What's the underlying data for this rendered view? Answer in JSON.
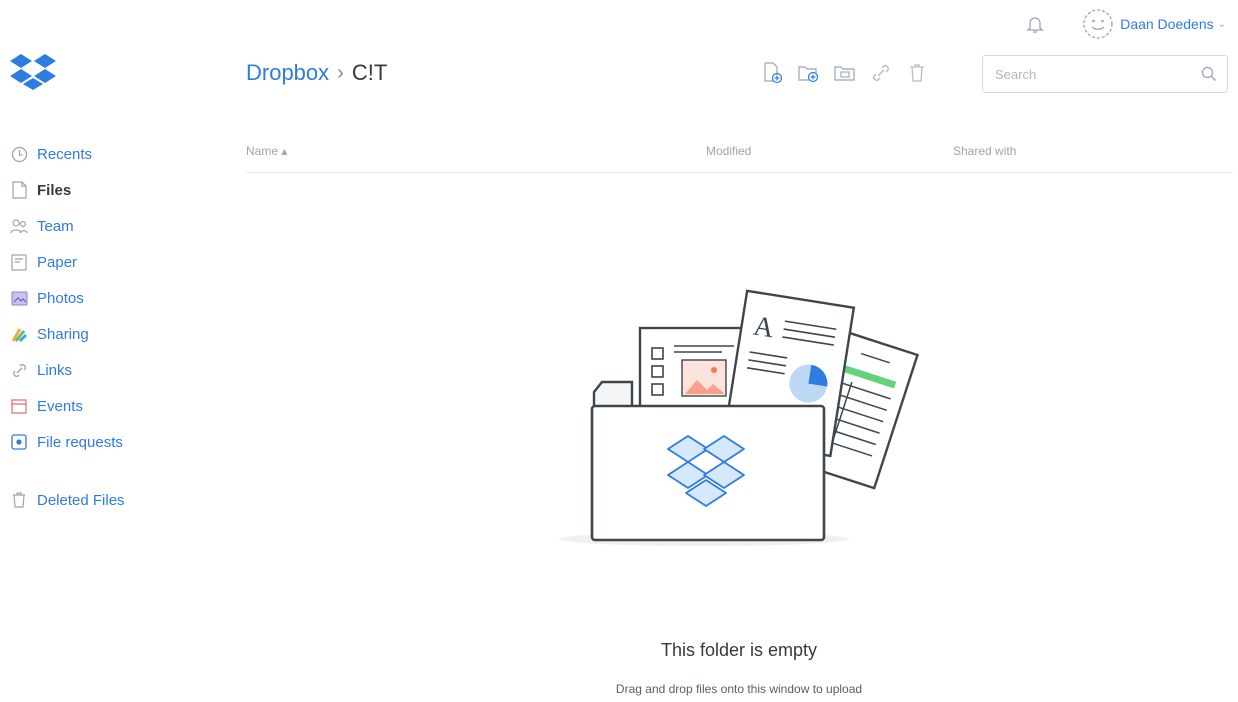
{
  "app": {
    "brand_color": "#2f7ce0",
    "logo_icon": "dropbox-logo-icon"
  },
  "sidebar": {
    "items": [
      {
        "label": "Recents",
        "icon": "clock-icon"
      },
      {
        "label": "Files",
        "icon": "file-icon",
        "active": true
      },
      {
        "label": "Team",
        "icon": "team-icon"
      },
      {
        "label": "Paper",
        "icon": "paper-icon"
      },
      {
        "label": "Photos",
        "icon": "photo-icon"
      },
      {
        "label": "Sharing",
        "icon": "sharing-icon"
      },
      {
        "label": "Links",
        "icon": "link-icon"
      },
      {
        "label": "Events",
        "icon": "calendar-icon"
      },
      {
        "label": "File requests",
        "icon": "file-request-icon"
      }
    ],
    "deleted": {
      "label": "Deleted Files",
      "icon": "trash-icon"
    }
  },
  "breadcrumb": {
    "root": "Dropbox",
    "separator": "›",
    "current": "C!T"
  },
  "account": {
    "name": "Daan Doedens",
    "caret": "⌄"
  },
  "toolbar": {
    "buttons": [
      "upload-file-icon",
      "new-folder-icon",
      "shared-folder-icon",
      "link-icon",
      "trash-icon"
    ]
  },
  "search": {
    "placeholder": "Search",
    "value": ""
  },
  "table": {
    "columns": [
      "Name ▴",
      "Modified",
      "Shared with"
    ]
  },
  "empty_state": {
    "title": "This folder is empty",
    "subtitle": "Drag and drop files onto this window to upload"
  }
}
